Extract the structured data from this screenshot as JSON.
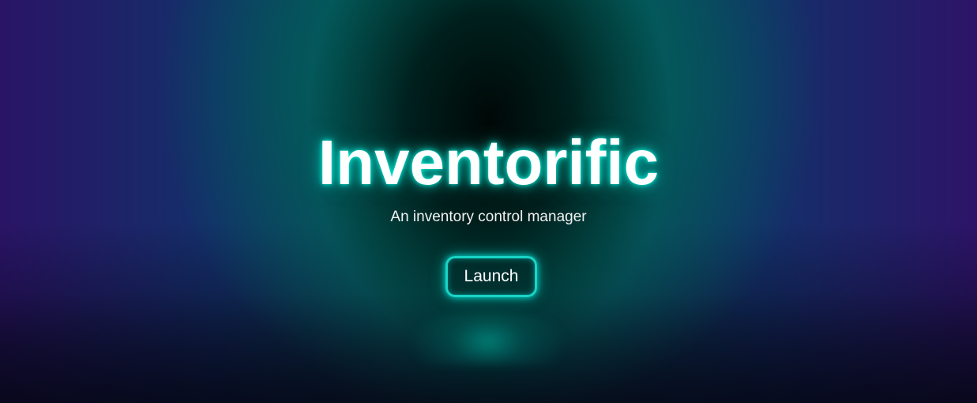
{
  "app": {
    "title": "Inventorific",
    "subtitle": "An inventory control manager"
  },
  "actions": {
    "launch_label": "Launch"
  },
  "colors": {
    "accent_glow": "#19d4c7",
    "text": "#ffffff",
    "edge_left": "#2a1466",
    "edge_right": "#2d1468",
    "center_teal": "#006e64"
  }
}
